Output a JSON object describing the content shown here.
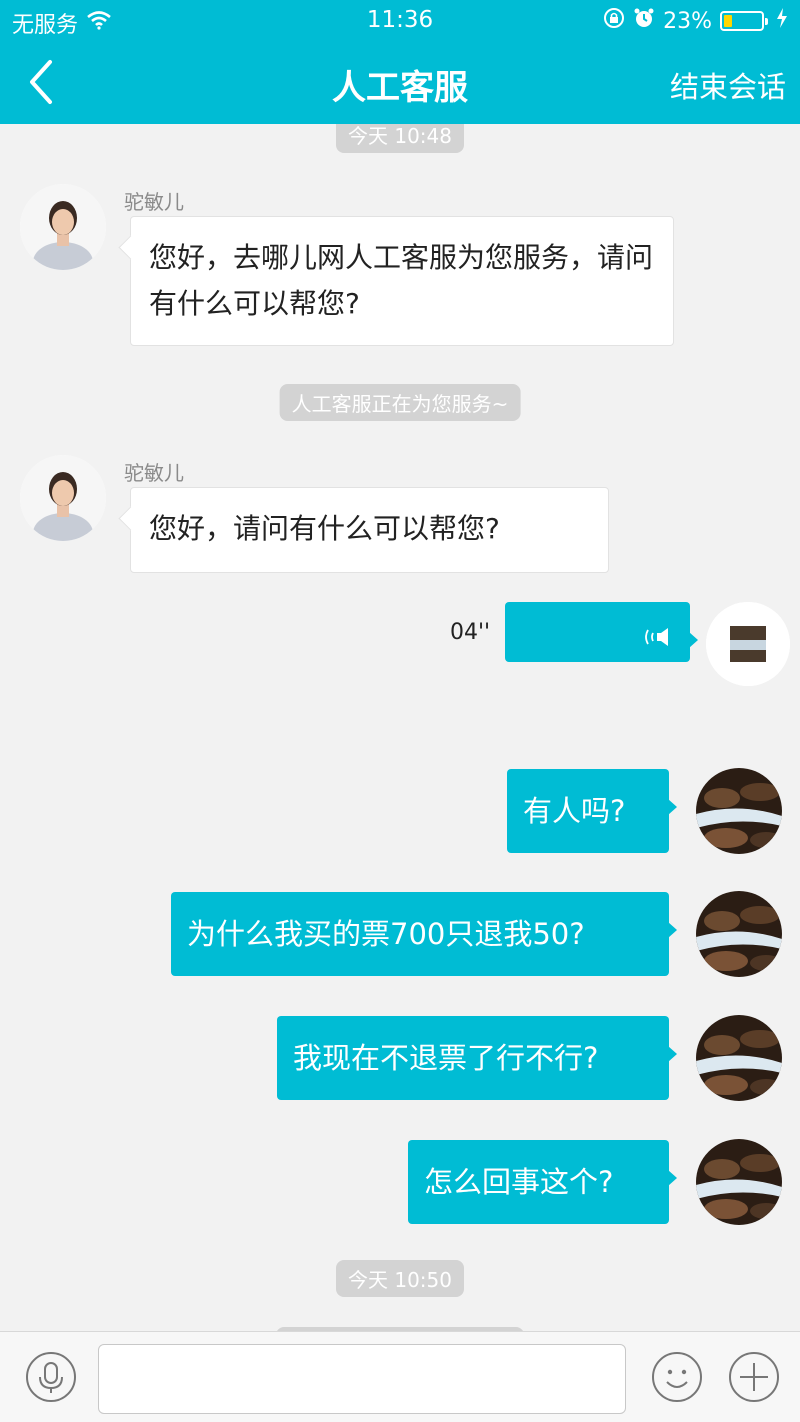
{
  "status_bar": {
    "carrier": "无服务",
    "time": "11:36",
    "battery": "23%",
    "battery_level": 0.23
  },
  "nav": {
    "title": "人工客服",
    "end_session": "结束会话"
  },
  "chat": {
    "timestamp_top": "今天 10:48",
    "agent_name_1": "驼敏儿",
    "agent_msg_1": "您好，去哪儿网人工客服为您服务，请问有什么可以帮您?",
    "system_notice": "人工客服正在为您服务~",
    "agent_name_2": "驼敏儿",
    "agent_msg_2": "您好，请问有什么可以帮您?",
    "voice_duration": "04''",
    "user_msg_1": "有人吗?",
    "user_msg_2": "为什么我买的票700只退我50?",
    "user_msg_3": "我现在不退票了行不行?",
    "user_msg_4": "怎么回事这个?",
    "timestamp_bottom": "今天 10:50"
  },
  "colors": {
    "brand": "#00bcd4",
    "background": "#f2f2f2"
  },
  "icons": {
    "wifi": "wifi-icon",
    "lock": "rotation-lock-icon",
    "alarm": "alarm-icon",
    "charging": "charging-bolt-icon",
    "back": "chevron-left-icon",
    "speaker": "speaker-icon",
    "mic": "microphone-icon",
    "emoji": "smiley-icon",
    "plus": "plus-icon"
  }
}
